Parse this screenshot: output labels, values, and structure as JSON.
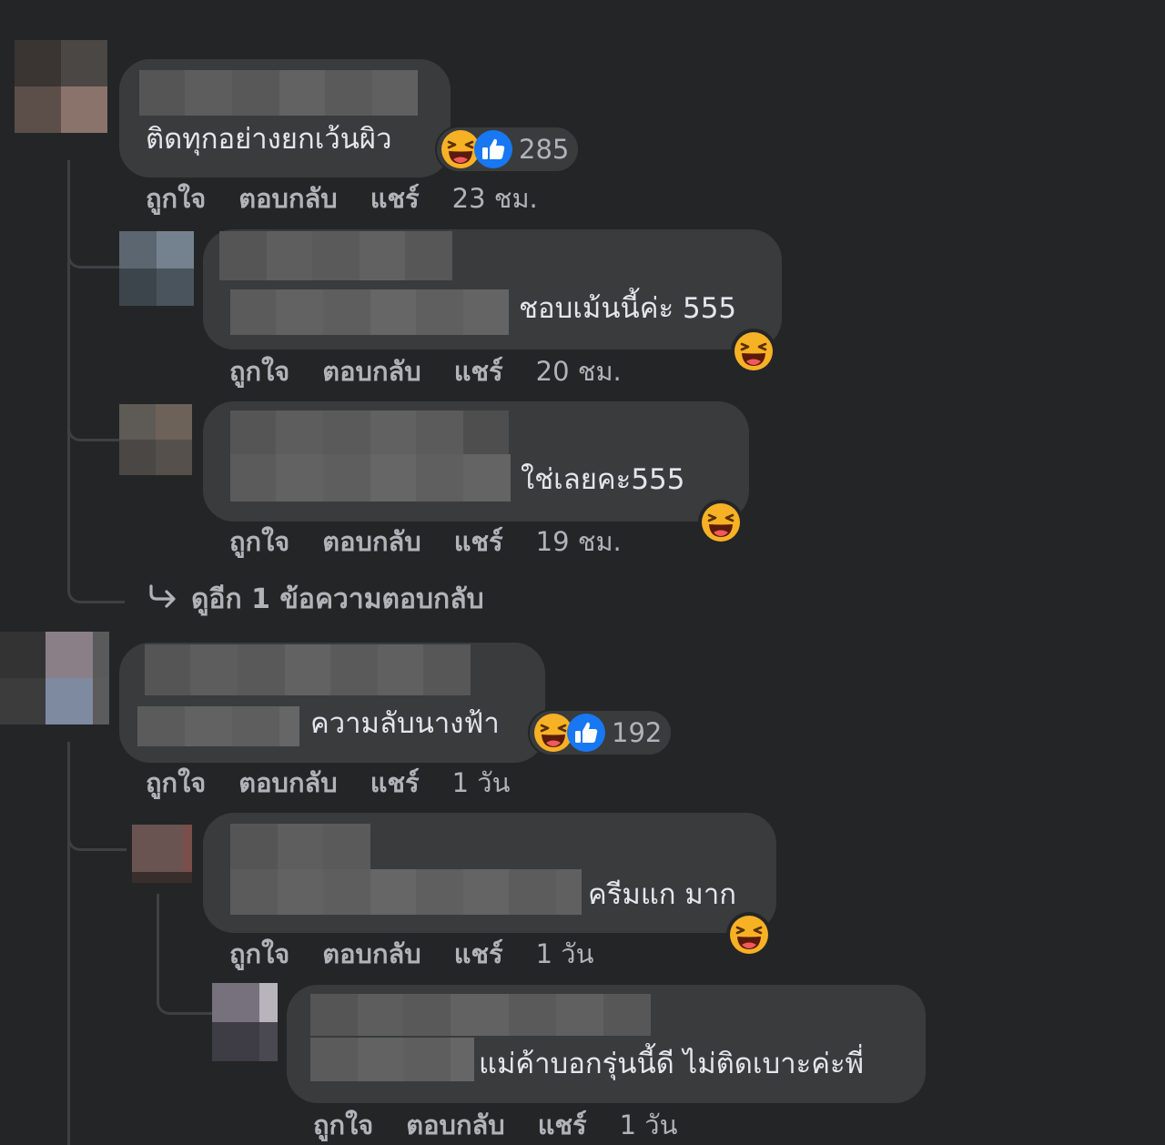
{
  "comments": [
    {
      "text": "ติดทุกอย่างยกเว้นผิว",
      "reactions": {
        "emojis": [
          "haha-icon",
          "like-icon"
        ],
        "count": "285"
      },
      "actions": {
        "like": "ถูกใจ",
        "reply": "ตอบกลับ",
        "share": "แชร์",
        "time": "23 ชม."
      },
      "replies": [
        {
          "text": "ชอบเม้นนี้ค่ะ 555",
          "actions": {
            "like": "ถูกใจ",
            "reply": "ตอบกลับ",
            "share": "แชร์",
            "time": "20 ชม."
          }
        },
        {
          "text": "ใช่เลยคะ555",
          "actions": {
            "like": "ถูกใจ",
            "reply": "ตอบกลับ",
            "share": "แชร์",
            "time": "19 ชม."
          }
        }
      ],
      "more_replies": {
        "icon": "reply-arrow-icon",
        "label": "ดูอีก 1 ข้อความตอบกลับ"
      }
    },
    {
      "text": "ความลับนางฟ้า",
      "reactions": {
        "emojis": [
          "haha-icon",
          "like-icon"
        ],
        "count": "192"
      },
      "actions": {
        "like": "ถูกใจ",
        "reply": "ตอบกลับ",
        "share": "แชร์",
        "time": "1 วัน"
      },
      "replies": [
        {
          "text": "ครีมแก มาก",
          "actions": {
            "like": "ถูกใจ",
            "reply": "ตอบกลับ",
            "share": "แชร์",
            "time": "1 วัน"
          },
          "replies": [
            {
              "text": "แม่ค้าบอกรุ่นนี้ดี ไม่ติดเบาะค่ะพี่",
              "actions": {
                "like": "ถูกใจ",
                "reply": "ตอบกลับ",
                "share": "แชร์",
                "time": "1 วัน"
              }
            }
          ]
        }
      ]
    }
  ],
  "colors": {
    "background": "#242526",
    "bubble": "#3a3b3c",
    "text_primary": "#e4e6eb",
    "text_secondary": "#b0b3b8",
    "like_blue": "#1877f2",
    "haha_yellow": "#f7b125"
  }
}
